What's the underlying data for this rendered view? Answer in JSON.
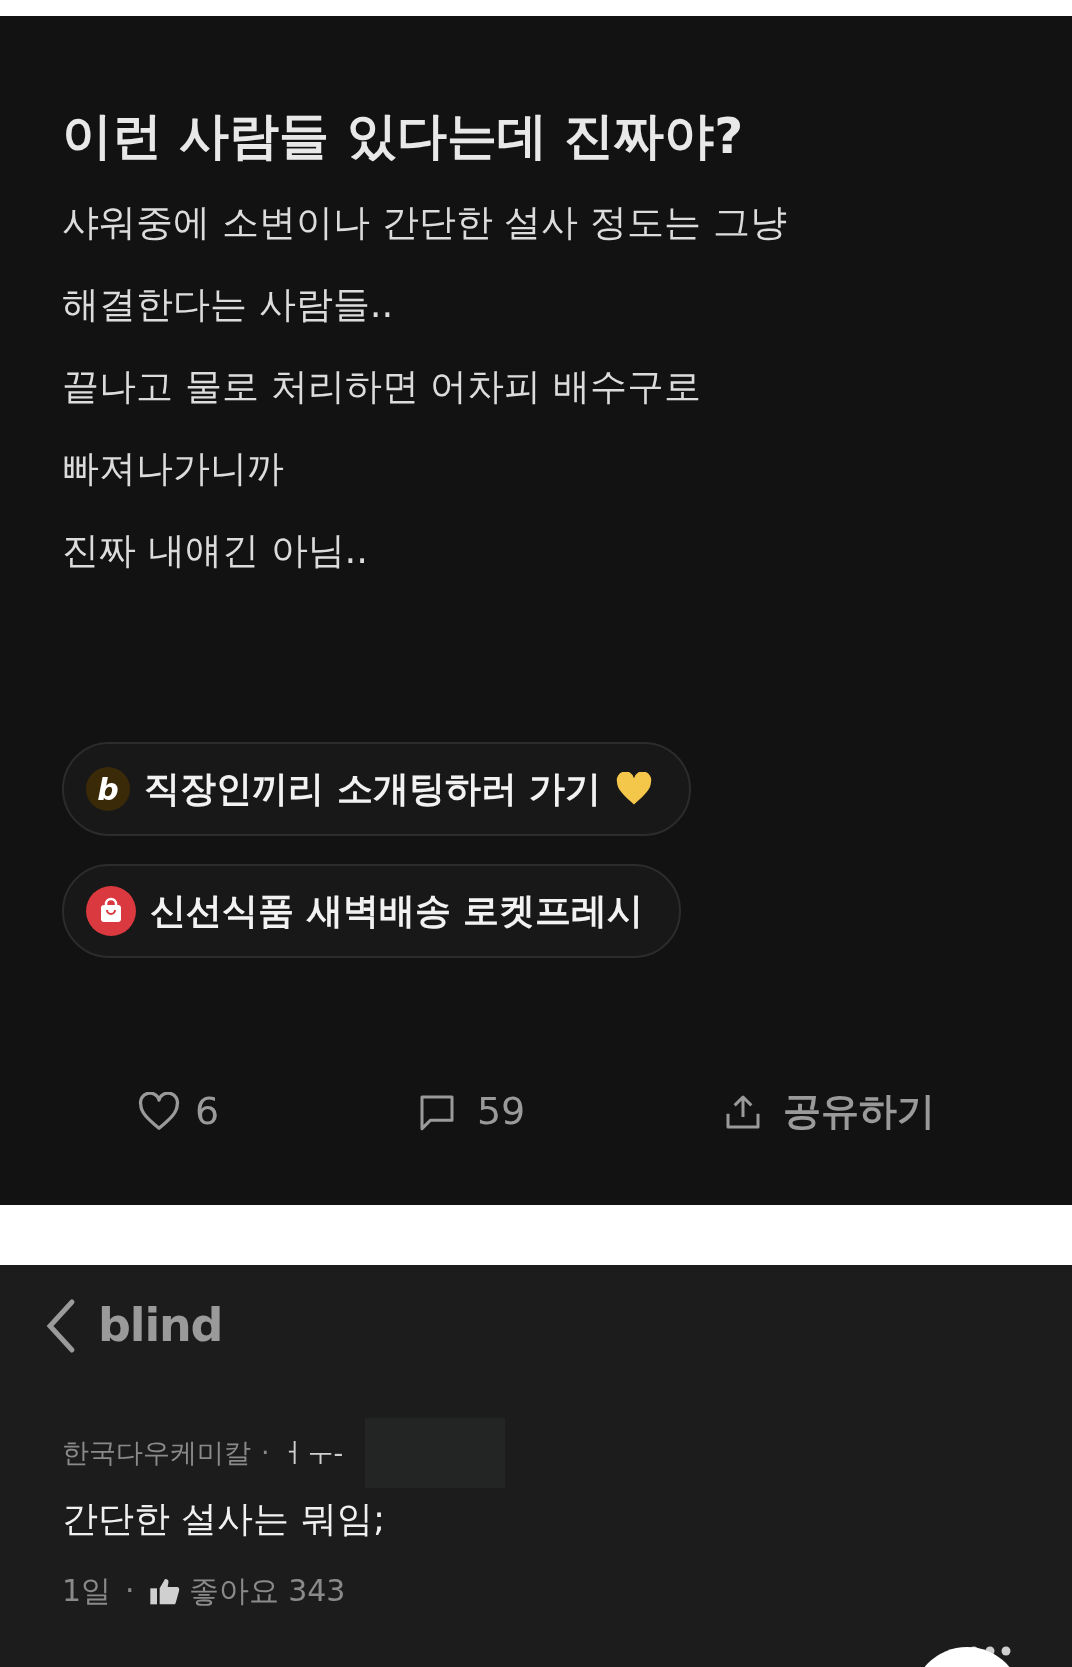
{
  "post": {
    "title": "이런 사람들 있다는데 진짜야?",
    "body_lines": [
      "샤워중에 소변이나 간단한 설사 정도는 그냥",
      "해결한다는 사람들..",
      "끝나고 물로 처리하면 어차피 배수구로",
      "빠져나가니까",
      "진짜 내얘긴 아님.."
    ]
  },
  "promos": [
    {
      "kind": "logo",
      "logo_text": "b",
      "label": "직장인끼리 소개팅하러 가기",
      "heart": true
    },
    {
      "kind": "bag",
      "label": "신선식품 새벽배송 로켓프레시",
      "heart": false
    }
  ],
  "actions": {
    "likes": "6",
    "comments": "59",
    "share": "공유하기"
  },
  "header": {
    "logo": "blind"
  },
  "comment": {
    "company": "한국다우케미칼",
    "separator": "·",
    "author": "ㅓㅜ-",
    "text": "간단한 설사는 뭐임;",
    "time": "1일",
    "dot": "·",
    "like_label": "좋아요 343"
  }
}
